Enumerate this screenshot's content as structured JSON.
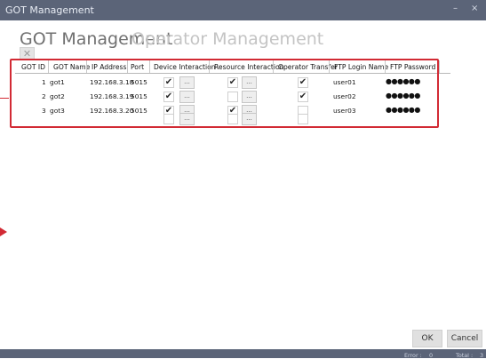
{
  "window": {
    "title": "GOT Management",
    "minimize_label": "–",
    "close_label": "×"
  },
  "tabs": [
    {
      "label": "GOT Management"
    },
    {
      "label": "Operator Management"
    }
  ],
  "toolbar": {
    "delete_label": "✕"
  },
  "table": {
    "columns": [
      "GOT ID",
      "GOT Name",
      "IP Address",
      "Port",
      "Device Interaction",
      "Resource Interaction",
      "Operator Transfer",
      "FTP Login Name",
      "FTP Password"
    ],
    "rows": [
      {
        "id": "1",
        "name": "got1",
        "ip": "192.168.3.18",
        "port": "5015",
        "device": true,
        "resource": true,
        "operator": true,
        "ftp_login": "user01",
        "ftp_password": "●●●●●●"
      },
      {
        "id": "2",
        "name": "got2",
        "ip": "192.168.3.19",
        "port": "5015",
        "device": true,
        "resource": false,
        "operator": true,
        "ftp_login": "user02",
        "ftp_password": "●●●●●●"
      },
      {
        "id": "3",
        "name": "got3",
        "ip": "192.168.3.20",
        "port": "5015",
        "device": true,
        "resource": true,
        "operator": false,
        "ftp_login": "user03",
        "ftp_password": "●●●●●●"
      },
      {
        "id": "",
        "name": "",
        "ip": "",
        "port": "",
        "device": false,
        "resource": false,
        "operator": false,
        "ftp_login": "",
        "ftp_password": ""
      }
    ],
    "details_button_label": "..."
  },
  "buttons": {
    "ok_label": "OK",
    "cancel_label": "Cancel"
  },
  "status": {
    "error_label": "Error :",
    "error_count": "0",
    "total_label": "Total :",
    "total_count": "3"
  }
}
